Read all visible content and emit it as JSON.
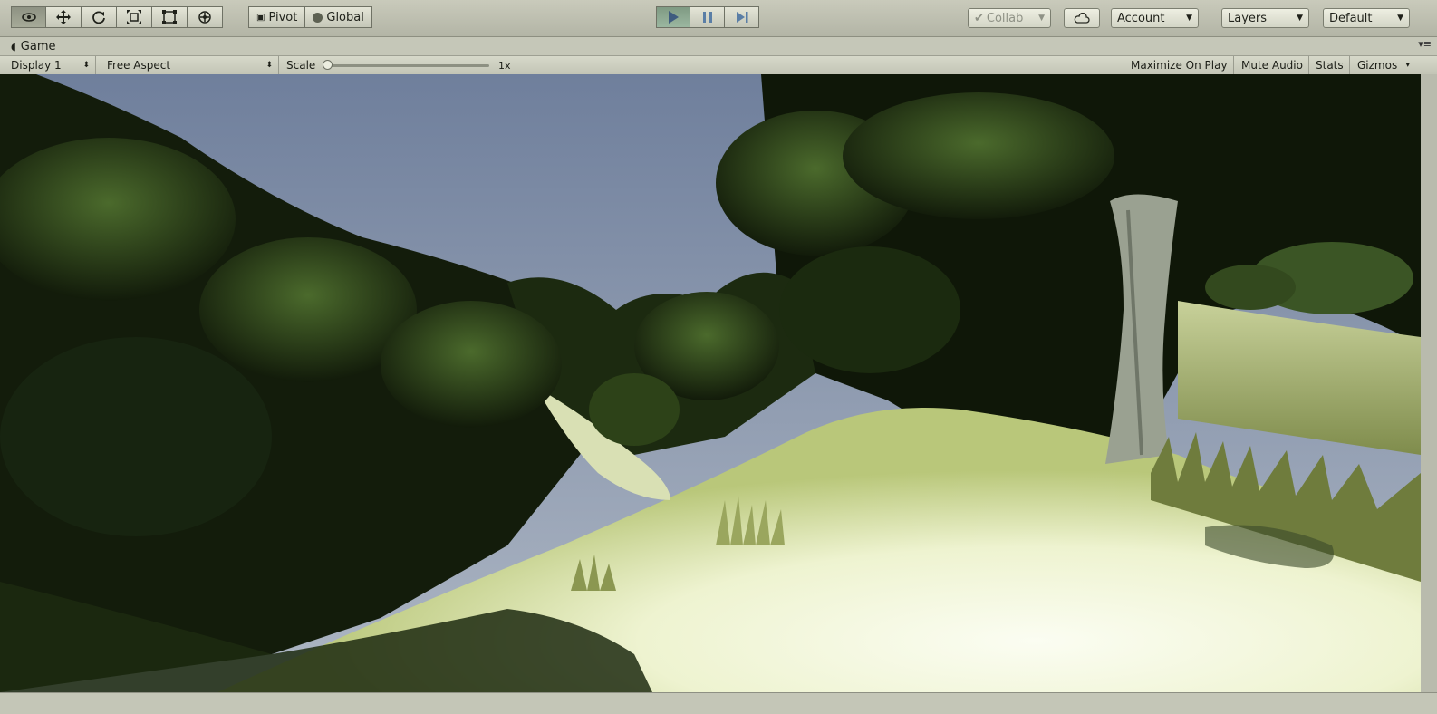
{
  "toolbar": {
    "tools": [
      {
        "name": "view-tool",
        "icon": "eye-icon",
        "active": true
      },
      {
        "name": "move-tool",
        "icon": "move-arrows-icon",
        "active": false
      },
      {
        "name": "rotate-tool",
        "icon": "rotate-icon",
        "active": false
      },
      {
        "name": "scale-tool",
        "icon": "scale-icon",
        "active": false
      },
      {
        "name": "rect-tool",
        "icon": "rect-transform-icon",
        "active": false
      },
      {
        "name": "transform-tool",
        "icon": "transform-icon",
        "active": false
      }
    ],
    "pivot_label": "Pivot",
    "global_label": "Global",
    "play_active": true,
    "collab_label": "Collab",
    "account_label": "Account",
    "layers_label": "Layers",
    "layout_label": "Default"
  },
  "game_panel": {
    "tab_label": "Game",
    "display_label": "Display 1",
    "aspect_label": "Free Aspect",
    "scale_label": "Scale",
    "scale_value": "1x",
    "scale_fraction": 0.0,
    "maximize_label": "Maximize On Play",
    "mute_label": "Mute Audio",
    "stats_label": "Stats",
    "gizmos_label": "Gizmos"
  },
  "colors": {
    "toolbar_bg": "#c4c6b7",
    "play_active": "#8faa94",
    "sky": "#7a8aa6",
    "foliage_dark": "#151f0c",
    "foliage_mid": "#3e5426",
    "path_light": "#f3f6e2"
  }
}
